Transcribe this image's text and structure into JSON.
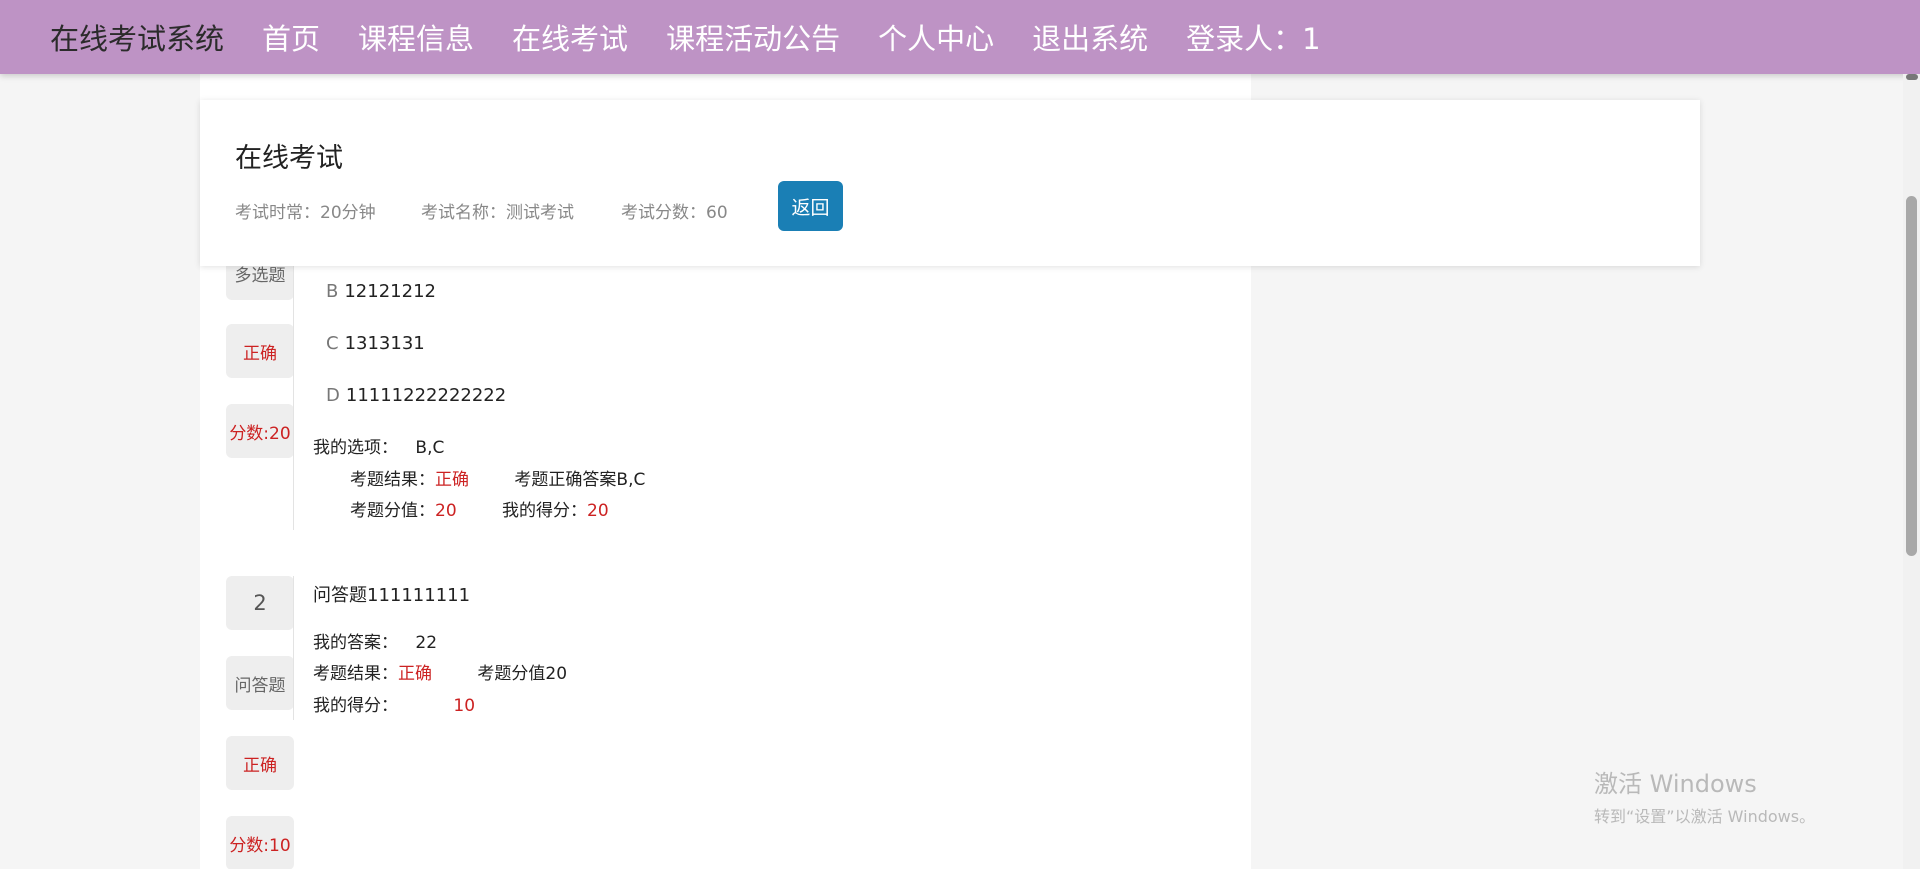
{
  "nav": {
    "brand": "在线考试系统",
    "items": [
      "首页",
      "课程信息",
      "在线考试",
      "课程活动公告",
      "个人中心",
      "退出系统"
    ],
    "login": "登录人：1"
  },
  "exam": {
    "title": "在线考试",
    "duration": "考试时常：20分钟",
    "name": "考试名称：测试考试",
    "score": "考试分数：60",
    "back_label": "返回"
  },
  "question1": {
    "type": "多选题",
    "status": "正确",
    "points": "分数:20",
    "options": [
      {
        "letter": "B",
        "text": "12121212"
      },
      {
        "letter": "C",
        "text": "1313131"
      },
      {
        "letter": "D",
        "text": "11111222222222"
      }
    ],
    "my_choice_label": "我的选项：",
    "my_choice": "B,C",
    "result_label": "考题结果：",
    "result": "正确",
    "correct_answer": "考题正确答案B,C",
    "value_label": "考题分值：",
    "value": "20",
    "my_score_label": "我的得分：",
    "my_score": "20"
  },
  "question2": {
    "number": "2",
    "type": "问答题",
    "status": "正确",
    "points": "分数:10",
    "text": "问答题111111111",
    "my_answer_label": "我的答案：",
    "my_answer": "22",
    "result_label": "考题结果：",
    "result": "正确",
    "value": "考题分值20",
    "my_score_label": "我的得分：",
    "my_score": "10"
  },
  "watermark": {
    "line1": "激活 Windows",
    "line2": "转到“设置”以激活 Windows。"
  }
}
